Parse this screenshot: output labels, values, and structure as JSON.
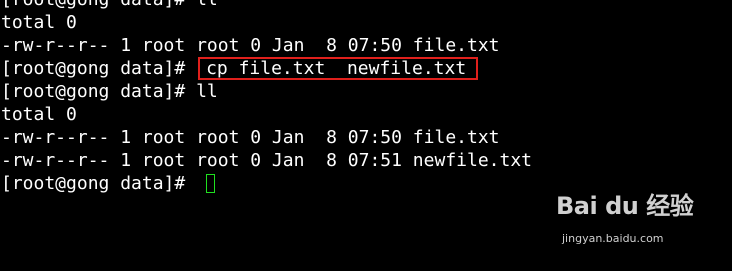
{
  "terminal": {
    "lines": [
      "[root@gong data]# ll",
      "total 0",
      "-rw-r--r-- 1 root root 0 Jan  8 07:50 file.txt",
      "[root@gong data]# ",
      "cp file.txt  newfile.txt",
      "[root@gong data]# ll",
      "total 0",
      "-rw-r--r-- 1 root root 0 Jan  8 07:50 file.txt",
      "-rw-r--r-- 1 root root 0 Jan  8 07:51 newfile.txt",
      "[root@gong data]# "
    ]
  },
  "watermark": {
    "logo": "Bai du 经验",
    "url": "jingyan.baidu.com"
  },
  "colors": {
    "background": "#000000",
    "text": "#ffffff",
    "highlight_border": "#e0201c",
    "cursor": "#1fe01f"
  }
}
